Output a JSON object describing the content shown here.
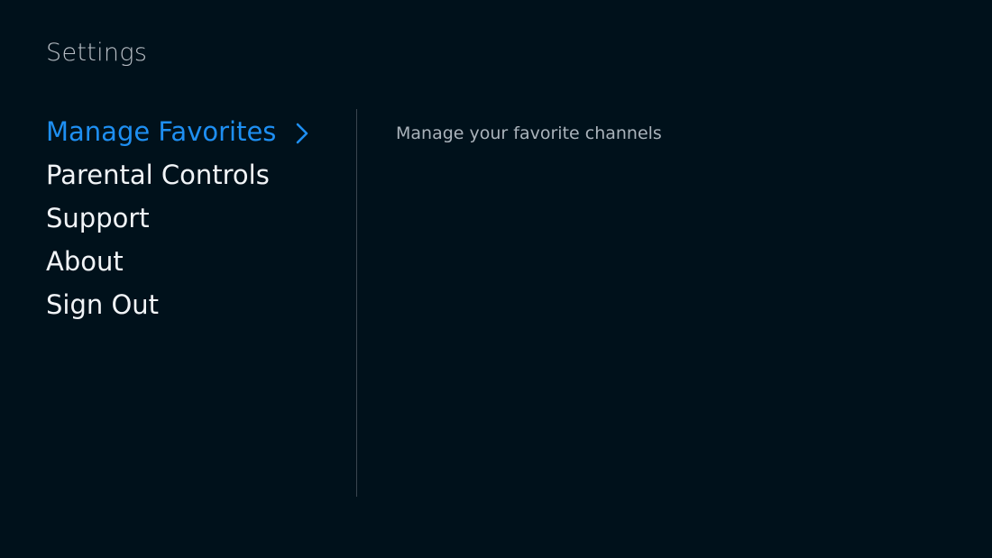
{
  "header": {
    "title": "Settings"
  },
  "menu": {
    "items": [
      {
        "label": "Manage Favorites",
        "selected": true
      },
      {
        "label": "Parental Controls",
        "selected": false
      },
      {
        "label": "Support",
        "selected": false
      },
      {
        "label": "About",
        "selected": false
      },
      {
        "label": "Sign Out",
        "selected": false
      }
    ],
    "selected_icon": "chevron-right-icon"
  },
  "detail": {
    "description": "Manage your favorite channels"
  },
  "colors": {
    "background": "#00111b",
    "accent": "#1e8ff2",
    "text": "#f1f4f7",
    "muted_text": "#aab3bb",
    "divider": "#3a4650"
  }
}
